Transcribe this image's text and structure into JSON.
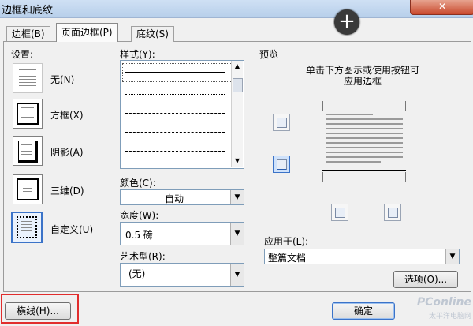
{
  "window": {
    "title": "边框和底纹",
    "close_glyph": "✕"
  },
  "overlay": {
    "zoom_glyph": "+"
  },
  "tabs": [
    {
      "label": "边框(B)"
    },
    {
      "label": "页面边框(P)"
    },
    {
      "label": "底纹(S)"
    }
  ],
  "settings": {
    "heading": "设置:",
    "items": [
      {
        "label": "无(N)"
      },
      {
        "label": "方框(X)"
      },
      {
        "label": "阴影(A)"
      },
      {
        "label": "三维(D)"
      },
      {
        "label": "自定义(U)"
      }
    ]
  },
  "style": {
    "label": "样式(Y):"
  },
  "color": {
    "label": "颜色(C):",
    "value": "自动"
  },
  "width": {
    "label": "宽度(W):",
    "value": "0.5 磅"
  },
  "art": {
    "label": "艺术型(R):",
    "value": "(无)"
  },
  "preview": {
    "heading": "预览",
    "instruction_line1": "单击下方图示或使用按钮可",
    "instruction_line2": "应用边框"
  },
  "apply_to": {
    "label": "应用于(L):",
    "value": "整篇文档"
  },
  "buttons": {
    "options": "选项(O)...",
    "horizontal_line": "横线(H)...",
    "ok": "确定"
  },
  "watermark": {
    "brand": "PConline",
    "tagline": "太平洋电脑网"
  },
  "colors": {
    "highlight_red": "#e12d2d",
    "selected_blue": "#3b73c8"
  }
}
